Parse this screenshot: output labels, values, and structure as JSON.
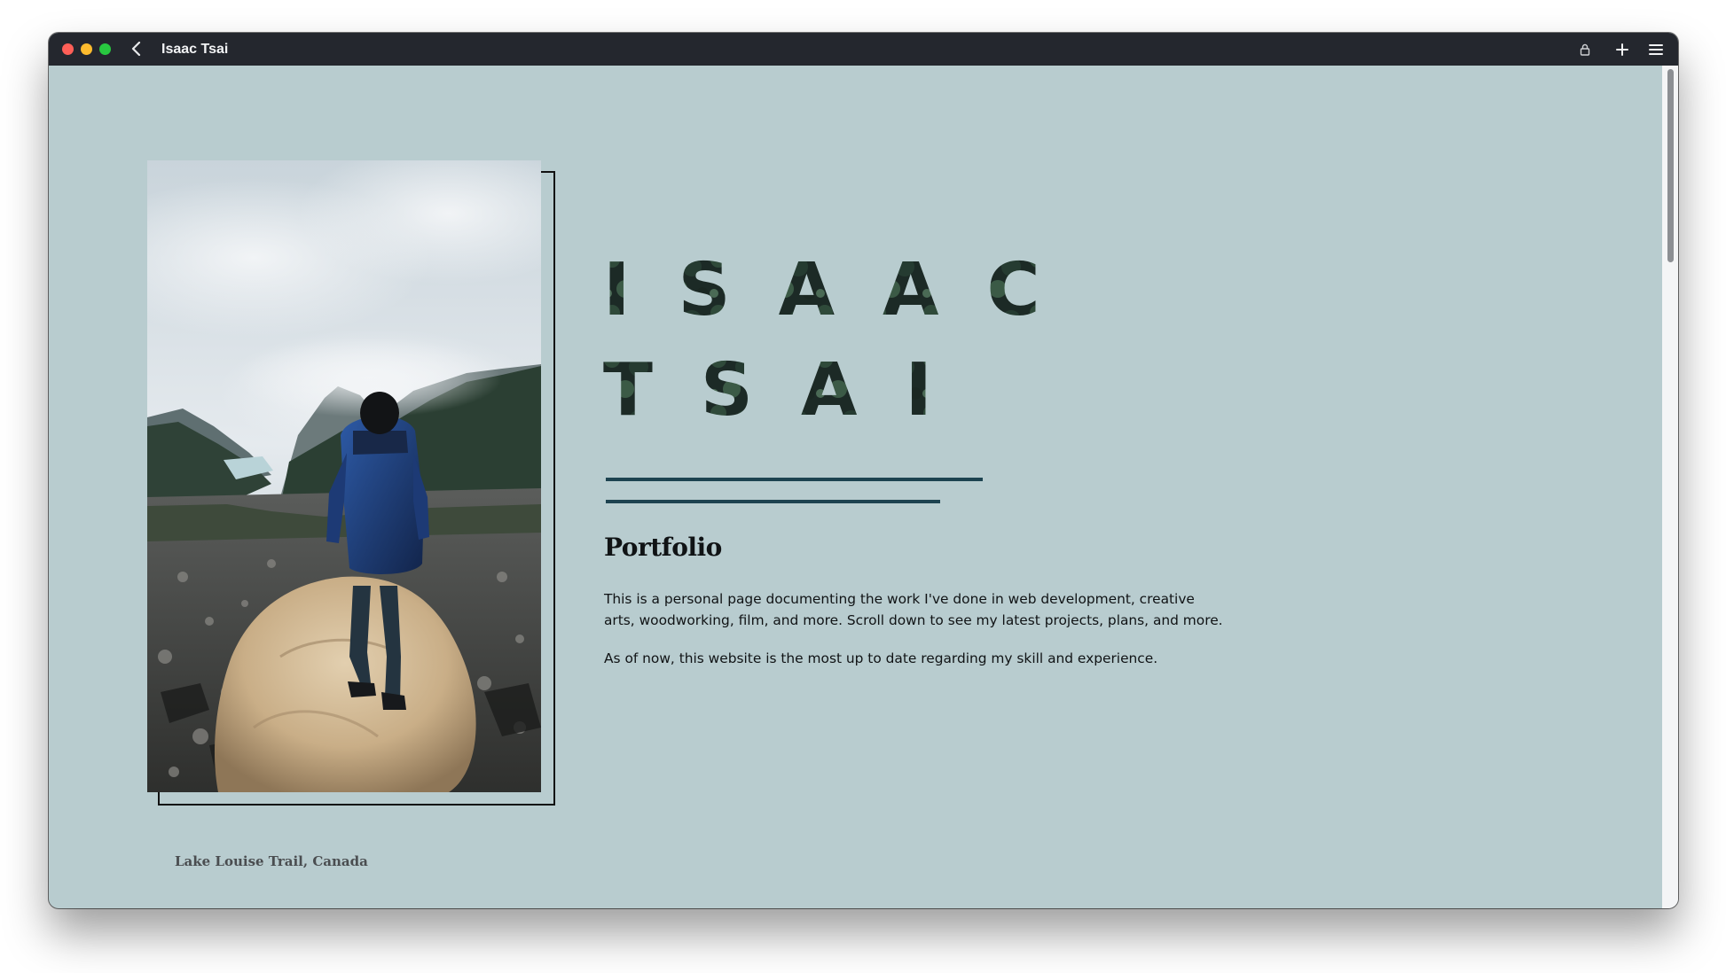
{
  "window": {
    "title": "Isaac Tsai"
  },
  "toolbar": {
    "icons": [
      "chevron-left-icon",
      "lock-icon",
      "plus-icon",
      "hamburger-menu-icon"
    ]
  },
  "hero": {
    "name_line_1": "ISAAC",
    "name_line_2": "TSAI",
    "photo_caption": "Lake Louise Trail, Canada",
    "section_title": "Portfolio",
    "paragraph_1": "This is a personal page documenting the work I've done in web development, creative arts, woodworking, film, and more. Scroll down to see my latest projects, plans, and more.",
    "paragraph_2": "As of now, this website is the most up to date regarding my skill and experience."
  },
  "colors": {
    "page_background": "#b8cccf",
    "titlebar": "#24272e",
    "rule": "#1d4350",
    "text": "#101315"
  }
}
